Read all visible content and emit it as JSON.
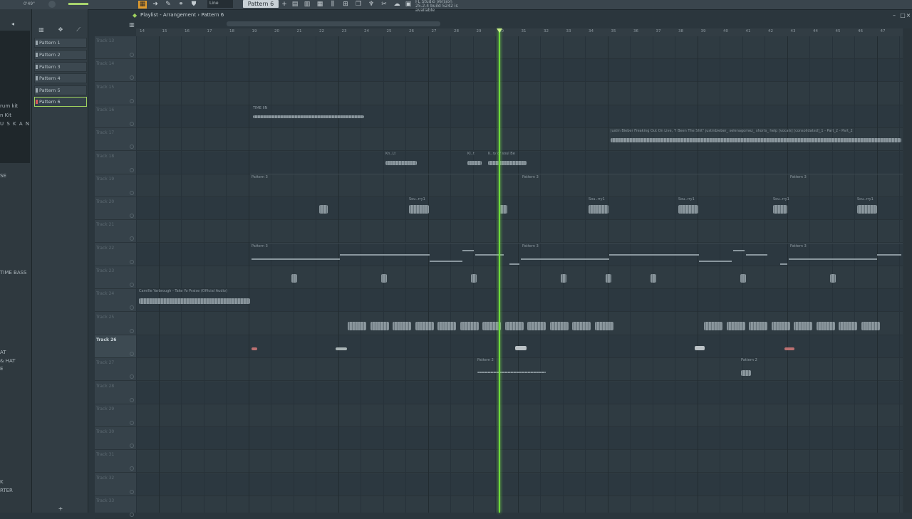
{
  "topbar": {
    "time": "0'49\"",
    "snap_value": "Line",
    "current_pattern": "Pattern 6",
    "update_line1": "FL Studio Version",
    "update_line2": "25.2.4 build 5242 is available"
  },
  "playlist": {
    "title": "Playlist - Arrangement",
    "separator": "›",
    "pattern": "Pattern 6"
  },
  "patterns": [
    {
      "label": "Pattern 1"
    },
    {
      "label": "Pattern 2"
    },
    {
      "label": "Pattern 3"
    },
    {
      "label": "Pattern 4"
    },
    {
      "label": "Pattern 5"
    },
    {
      "label": "Pattern 6",
      "selected": true
    }
  ],
  "browser": {
    "items": [
      {
        "label": "rum kit"
      },
      {
        "label": "n Kit"
      },
      {
        "label": "U S K A N A"
      },
      {
        "label": "SE"
      },
      {
        "label": "TIME BASS"
      },
      {
        "label": "AT"
      },
      {
        "label": "& HAT"
      },
      {
        "label": "E"
      },
      {
        "label": "K"
      },
      {
        "label": "RTER"
      }
    ]
  },
  "ruler": {
    "bars": [
      "14",
      "15",
      "16",
      "17",
      "18",
      "19",
      "20",
      "21",
      "22",
      "23",
      "24",
      "25",
      "26",
      "27",
      "28",
      "29",
      "30",
      "31",
      "32",
      "33",
      "34",
      "35",
      "36",
      "37",
      "38",
      "39",
      "40",
      "41",
      "42",
      "43",
      "44",
      "45",
      "46",
      "47"
    ]
  },
  "tracks": [
    {
      "name": "Track 13"
    },
    {
      "name": "Track 14"
    },
    {
      "name": "Track 15"
    },
    {
      "name": "Track 16"
    },
    {
      "name": "Track 17"
    },
    {
      "name": "Track 18"
    },
    {
      "name": "Track 19"
    },
    {
      "name": "Track 20"
    },
    {
      "name": "Track 21"
    },
    {
      "name": "Track 22"
    },
    {
      "name": "Track 23"
    },
    {
      "name": "Track 24"
    },
    {
      "name": "Track 25"
    },
    {
      "name": "Track 26",
      "active": true
    },
    {
      "name": "Track 27"
    },
    {
      "name": "Track 28"
    },
    {
      "name": "Track 29"
    },
    {
      "name": "Track 30"
    },
    {
      "name": "Track 31"
    },
    {
      "name": "Track 32"
    },
    {
      "name": "Track 33"
    }
  ],
  "clips": {
    "c_time": "TIME IIN",
    "c_justin": "Justin Bieber Freaking Out On Live, \"I Been The Shit\" justinbieber_ selenagomez_ shorts_ help [vocals] [consolidated]_1 - Part_2 - Part_2",
    "c_p3a": "Pattern 3",
    "c_p3b": "Pattern 3",
    "c_p3c": "Pattern 3",
    "c_p3d": "Pattern 3",
    "c_p3e": "Pattern 3",
    "c_p3f": "Pattern 3",
    "c_sou1": "Sou..rry1",
    "c_sou2": "Sou..rry1",
    "c_sou3": "Sou..rry1",
    "c_sou4": "Sou..rry1",
    "c_sou5": "Sou..rry1",
    "c_s18a": "Kn..Lt",
    "c_s18b": "Kl..t",
    "c_s18c": "K..ry of soul Be",
    "c_yarb": "Camille Yarbrough - Take Yo Praise (Official Audio)",
    "c_p2a": "Pattern 2",
    "c_p2b": "Pattern 2"
  }
}
